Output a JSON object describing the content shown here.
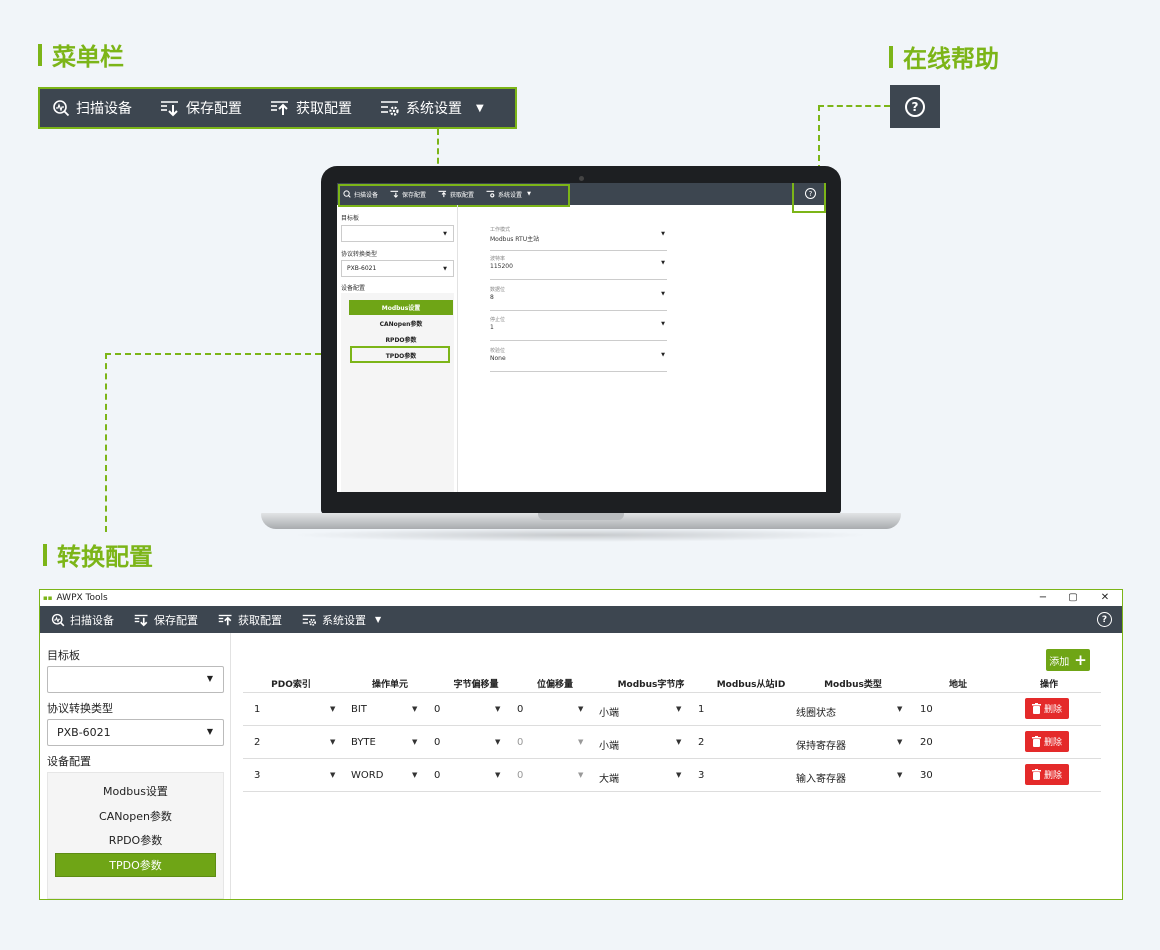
{
  "labels": {
    "menubar": "菜单栏",
    "help": "在线帮助",
    "convert": "转换配置"
  },
  "menu": {
    "scan": "扫描设备",
    "save": "保存配置",
    "fetch": "获取配置",
    "system": "系统设置",
    "help_symbol": "?"
  },
  "laptop": {
    "target_board_label": "目标板",
    "protocol_type_label": "协议转换类型",
    "protocol_value": "PXB-6021",
    "device_config_label": "设备配置",
    "nav": [
      "Modbus设置",
      "CANopen参数",
      "RPDO参数",
      "TPDO参数"
    ],
    "active_nav": 0,
    "fields": [
      {
        "label": "工作模式",
        "value": "Modbus RTU主站"
      },
      {
        "label": "波特率",
        "value": "115200"
      },
      {
        "label": "数据位",
        "value": "8"
      },
      {
        "label": "停止位",
        "value": "1"
      },
      {
        "label": "校验位",
        "value": "None"
      }
    ]
  },
  "app": {
    "title": "AWPX Tools",
    "window_controls": [
      "−",
      "▢",
      "✕"
    ],
    "target_board_label": "目标板",
    "target_board_value": "",
    "protocol_type_label": "协议转换类型",
    "protocol_value": "PXB-6021",
    "device_config_label": "设备配置",
    "nav": [
      "Modbus设置",
      "CANopen参数",
      "RPDO参数",
      "TPDO参数"
    ],
    "active_nav": 3,
    "add_label": "添加",
    "delete_label": "删除",
    "columns": [
      "PDO索引",
      "操作单元",
      "字节偏移量",
      "位偏移量",
      "Modbus字节序",
      "Modbus从站ID",
      "Modbus类型",
      "地址",
      "操作"
    ],
    "rows": [
      {
        "pdo": "1",
        "unit": "BIT",
        "byte_offset": "0",
        "bit_offset": "0",
        "bit_offset_disabled": false,
        "byte_order": "小端",
        "slave_id": "1",
        "mtype": "线圈状态",
        "addr": "10"
      },
      {
        "pdo": "2",
        "unit": "BYTE",
        "byte_offset": "0",
        "bit_offset": "0",
        "bit_offset_disabled": true,
        "byte_order": "小端",
        "slave_id": "2",
        "mtype": "保持寄存器",
        "addr": "20"
      },
      {
        "pdo": "3",
        "unit": "WORD",
        "byte_offset": "0",
        "bit_offset": "0",
        "bit_offset_disabled": true,
        "byte_order": "大端",
        "slave_id": "3",
        "mtype": "输入寄存器",
        "addr": "30"
      }
    ]
  },
  "colors": {
    "accent": "#7cb518",
    "nav_active": "#6fa516",
    "menubar_bg": "#3d4650",
    "delete": "#e42a2a"
  }
}
